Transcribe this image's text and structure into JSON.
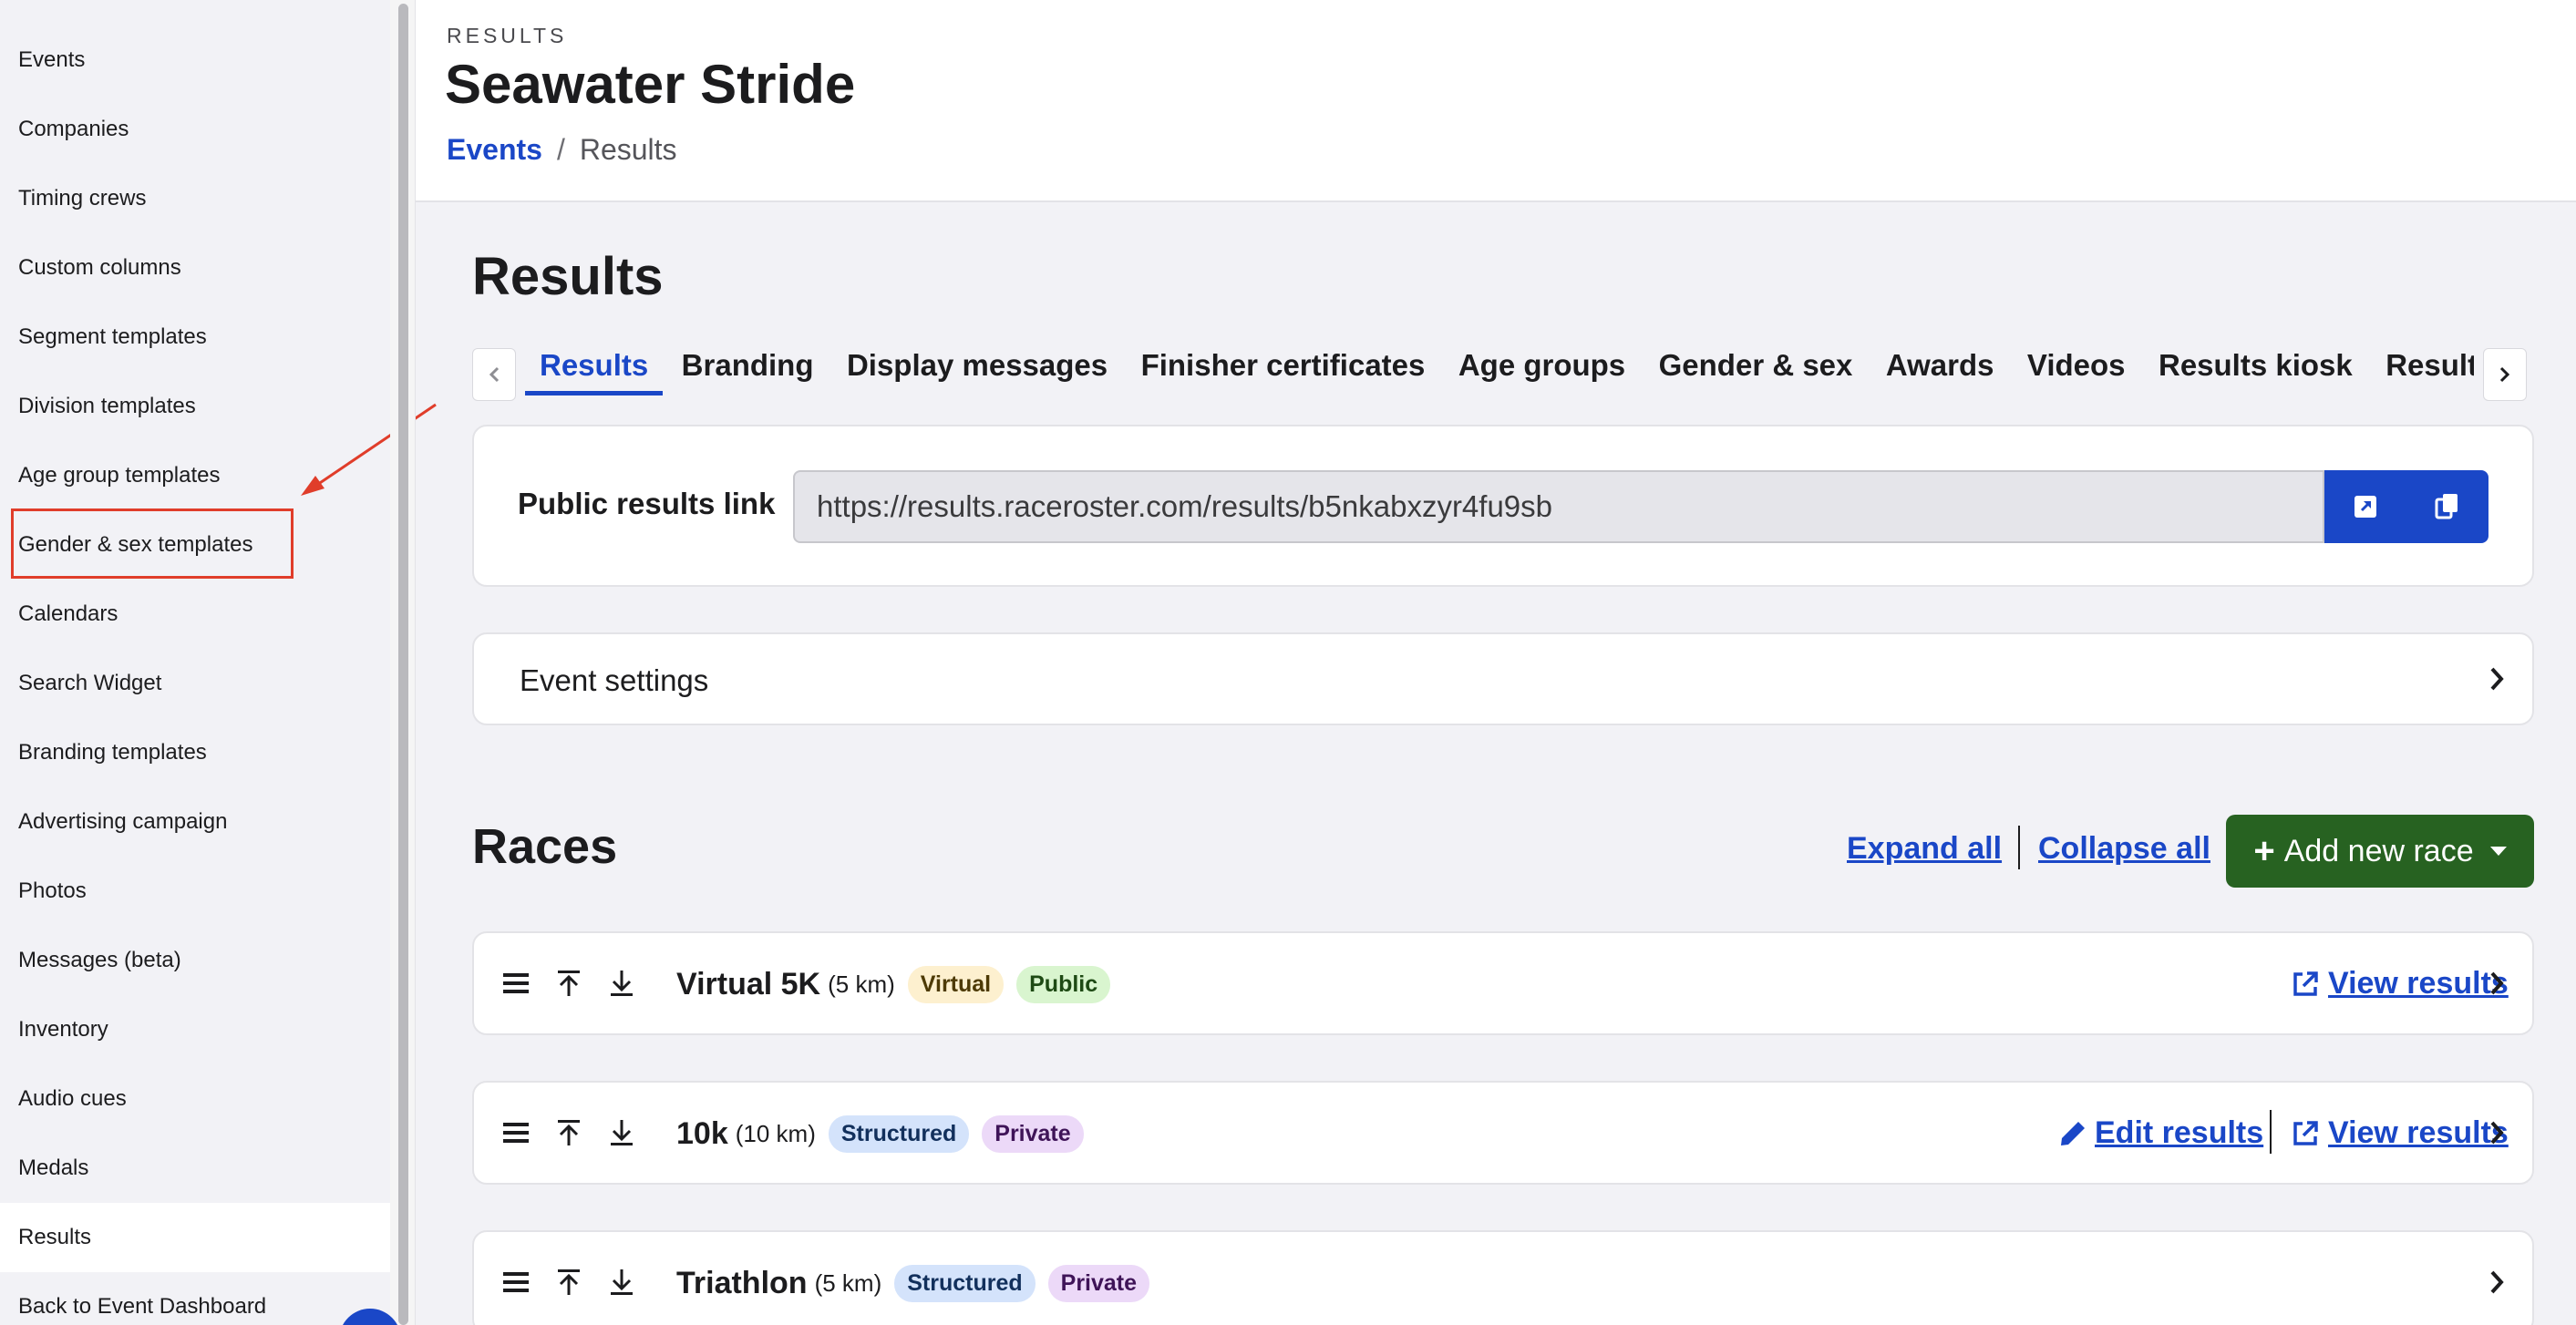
{
  "sidebar": {
    "items": [
      {
        "label": "Events"
      },
      {
        "label": "Companies"
      },
      {
        "label": "Timing crews"
      },
      {
        "label": "Custom columns"
      },
      {
        "label": "Segment templates"
      },
      {
        "label": "Division templates"
      },
      {
        "label": "Age group templates"
      },
      {
        "label": "Gender & sex templates"
      },
      {
        "label": "Calendars"
      },
      {
        "label": "Search Widget"
      },
      {
        "label": "Branding templates"
      },
      {
        "label": "Advertising campaign"
      },
      {
        "label": "Photos"
      },
      {
        "label": "Messages (beta)"
      },
      {
        "label": "Inventory"
      },
      {
        "label": "Audio cues"
      },
      {
        "label": "Medals"
      },
      {
        "label": "Results"
      },
      {
        "label": "Back to Event Dashboard"
      }
    ],
    "active_item": "Results",
    "highlighted_item": "Gender & sex templates"
  },
  "header": {
    "eyebrow": "RESULTS",
    "title": "Seawater Stride",
    "breadcrumb": {
      "link": "Events",
      "separator": "/",
      "current": "Results"
    }
  },
  "main": {
    "heading": "Results",
    "tabs": [
      {
        "label": "Results"
      },
      {
        "label": "Branding"
      },
      {
        "label": "Display messages"
      },
      {
        "label": "Finisher certificates"
      },
      {
        "label": "Age groups"
      },
      {
        "label": "Gender & sex"
      },
      {
        "label": "Awards"
      },
      {
        "label": "Videos"
      },
      {
        "label": "Results kiosk"
      },
      {
        "label": "Results embed"
      }
    ],
    "active_tab": "Results",
    "public_link": {
      "label": "Public results link",
      "value": "https://results.raceroster.com/results/b5nkabxzyr4fu9sb",
      "open_icon": "external-open-icon",
      "copy_icon": "copy-icon"
    },
    "event_settings": {
      "label": "Event settings"
    },
    "races": {
      "heading": "Races",
      "expand_all": "Expand all",
      "collapse_all": "Collapse all",
      "add_button": "Add new race",
      "items": [
        {
          "name": "Virtual 5K",
          "distance": "(5 km)",
          "badges": [
            "Virtual",
            "Public"
          ],
          "edit_label": "",
          "view_label": "View results"
        },
        {
          "name": "10k",
          "distance": "(10 km)",
          "badges": [
            "Structured",
            "Private"
          ],
          "edit_label": "Edit results",
          "view_label": "View results"
        },
        {
          "name": "Triathlon",
          "distance": "(5 km)",
          "badges": [
            "Structured",
            "Private"
          ],
          "edit_label": "",
          "view_label": ""
        }
      ]
    }
  },
  "colors": {
    "primary": "#1a47c7",
    "success": "#276221",
    "annotation": "#e03d2a",
    "background": "#f2f2f6"
  }
}
